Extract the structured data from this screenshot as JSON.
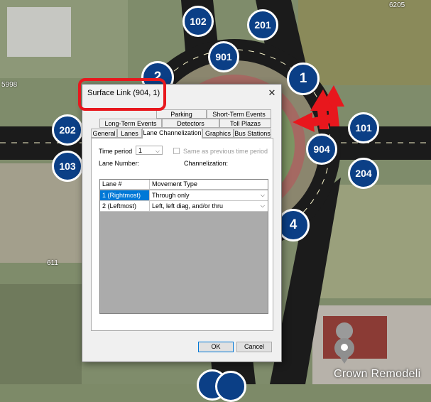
{
  "map": {
    "nodes": [
      {
        "id": "102",
        "size": "sm"
      },
      {
        "id": "201",
        "size": "sm"
      },
      {
        "id": "901",
        "size": "sm"
      },
      {
        "id": "2",
        "size": "lg"
      },
      {
        "id": "1",
        "size": "lg"
      },
      {
        "id": "202",
        "size": "sm"
      },
      {
        "id": "101",
        "size": "sm"
      },
      {
        "id": "904",
        "size": "sm"
      },
      {
        "id": "103",
        "size": "sm"
      },
      {
        "id": "204",
        "size": "sm"
      },
      {
        "id": "4",
        "size": "lg"
      }
    ],
    "labels": {
      "top_right": "6205",
      "left": "5998",
      "bottom_left": "611"
    },
    "business_label": "Crown Remodeli"
  },
  "dialog": {
    "title": "Surface Link (904, 1)",
    "close_glyph": "✕",
    "tabs_row1": [
      "Parking",
      "Short-Term Events"
    ],
    "tabs_row2": [
      "Long-Term Events",
      "Detectors",
      "Toll Plazas"
    ],
    "tabs_row3": [
      "General",
      "Lanes",
      "Lane Channelization",
      "Graphics",
      "Bus Stations"
    ],
    "active_tab": "Lane Channelization",
    "time_period_label": "Time period",
    "time_period_value": "1",
    "same_as_previous_label": "Same as previous time period",
    "lane_number_label": "Lane Number:",
    "channelization_label": "Channelization:",
    "grid": {
      "headers": [
        "Lane #",
        "Movement Type"
      ],
      "rows": [
        {
          "lane": "1  (Rightmost)",
          "movement": "Through only",
          "selected": true
        },
        {
          "lane": "2  (Leftmost)",
          "movement": "Left, left diag, and/or thru",
          "selected": false
        }
      ]
    },
    "ok_label": "OK",
    "cancel_label": "Cancel"
  },
  "colors": {
    "node": "#0b3f86",
    "highlight": "#e8171d",
    "selection": "#0078d7"
  }
}
